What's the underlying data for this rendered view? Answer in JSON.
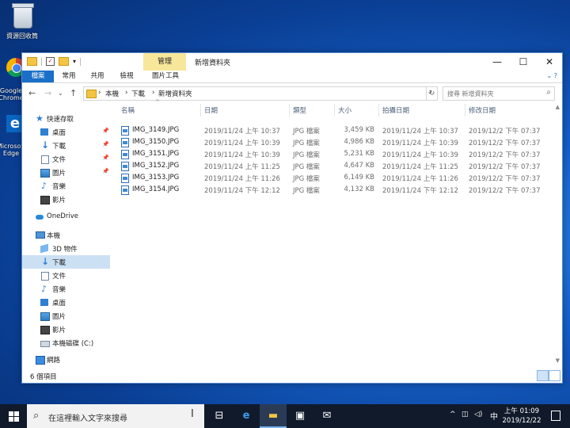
{
  "desktop": {
    "recycle_label": "資源回收筒",
    "chrome_label": "Google Chrome",
    "edge_label": "Microsoft Edge"
  },
  "window": {
    "context_tab": "管理",
    "title": "新增資料夾",
    "ribbon_tabs": [
      "檔案",
      "常用",
      "共用",
      "檢視",
      "圖片工具"
    ],
    "minimize": "—",
    "maximize": "☐",
    "close": "✕"
  },
  "address": {
    "crumbs": [
      "本機",
      "下載",
      "新增資料夾"
    ],
    "search_placeholder": "搜尋 新增資料夾"
  },
  "nav": {
    "items": [
      {
        "label": "快速存取",
        "icon": "star-icon"
      },
      {
        "label": "桌面",
        "icon": "desktop-icon",
        "pinned": true
      },
      {
        "label": "下載",
        "icon": "download-icon",
        "pinned": true
      },
      {
        "label": "文件",
        "icon": "document-icon",
        "pinned": true
      },
      {
        "label": "圖片",
        "icon": "picture-icon",
        "pinned": true
      },
      {
        "label": "音樂",
        "icon": "music-icon"
      },
      {
        "label": "影片",
        "icon": "video-icon"
      },
      {
        "label": "OneDrive",
        "icon": "onedrive-icon"
      },
      {
        "label": "本機",
        "icon": "computer-icon"
      },
      {
        "label": "3D 物件",
        "icon": "3d-objects-icon"
      },
      {
        "label": "下載",
        "icon": "download-icon",
        "selected": true
      },
      {
        "label": "文件",
        "icon": "document-icon"
      },
      {
        "label": "音樂",
        "icon": "music-icon"
      },
      {
        "label": "桌面",
        "icon": "desktop-icon"
      },
      {
        "label": "圖片",
        "icon": "picture-icon"
      },
      {
        "label": "影片",
        "icon": "video-icon"
      },
      {
        "label": "本機磁碟 (C:)",
        "icon": "drive-icon"
      },
      {
        "label": "網路",
        "icon": "network-icon"
      }
    ]
  },
  "columns": {
    "name": "名稱",
    "date": "日期",
    "type": "類型",
    "size": "大小",
    "taken": "拍攝日期",
    "modified": "修改日期"
  },
  "files": [
    {
      "name": "IMG_3149.JPG",
      "date": "2019/11/24 上午 10:37",
      "type": "JPG 檔案",
      "size": "3,459 KB",
      "taken": "2019/11/24 上午 10:37",
      "modified": "2019/12/2 下午 07:37"
    },
    {
      "name": "IMG_3150.JPG",
      "date": "2019/11/24 上午 10:39",
      "type": "JPG 檔案",
      "size": "4,986 KB",
      "taken": "2019/11/24 上午 10:39",
      "modified": "2019/12/2 下午 07:37"
    },
    {
      "name": "IMG_3151.JPG",
      "date": "2019/11/24 上午 10:39",
      "type": "JPG 檔案",
      "size": "5,231 KB",
      "taken": "2019/11/24 上午 10:39",
      "modified": "2019/12/2 下午 07:37"
    },
    {
      "name": "IMG_3152.JPG",
      "date": "2019/11/24 上午 11:25",
      "type": "JPG 檔案",
      "size": "4,647 KB",
      "taken": "2019/11/24 上午 11:25",
      "modified": "2019/12/2 下午 07:37"
    },
    {
      "name": "IMG_3153.JPG",
      "date": "2019/11/24 上午 11:26",
      "type": "JPG 檔案",
      "size": "6,149 KB",
      "taken": "2019/11/24 上午 11:26",
      "modified": "2019/12/2 下午 07:37"
    },
    {
      "name": "IMG_3154.JPG",
      "date": "2019/11/24 下午 12:12",
      "type": "JPG 檔案",
      "size": "4,132 KB",
      "taken": "2019/11/24 下午 12:12",
      "modified": "2019/12/2 下午 07:37"
    }
  ],
  "status": {
    "count": "6 個項目"
  },
  "taskbar": {
    "search_placeholder": "在這裡輸入文字來搜尋",
    "ime": "中",
    "time": "上午 01:09",
    "date": "2019/12/22"
  }
}
